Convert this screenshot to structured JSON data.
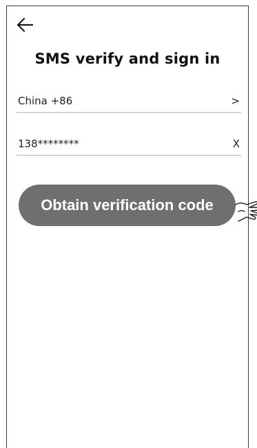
{
  "header": {
    "back_icon": "back-arrow-icon",
    "title": "SMS verify and sign in"
  },
  "form": {
    "country": {
      "value": "China +86",
      "action": ">"
    },
    "phone": {
      "value": "138********",
      "action": "X"
    },
    "obtain_button_label": "Obtain verification code"
  },
  "annotation": {
    "icon": "pointing-hand-icon"
  },
  "colors": {
    "button_bg": "#6f6f6f",
    "button_text": "#ffffff",
    "divider": "#b5b5b5"
  }
}
